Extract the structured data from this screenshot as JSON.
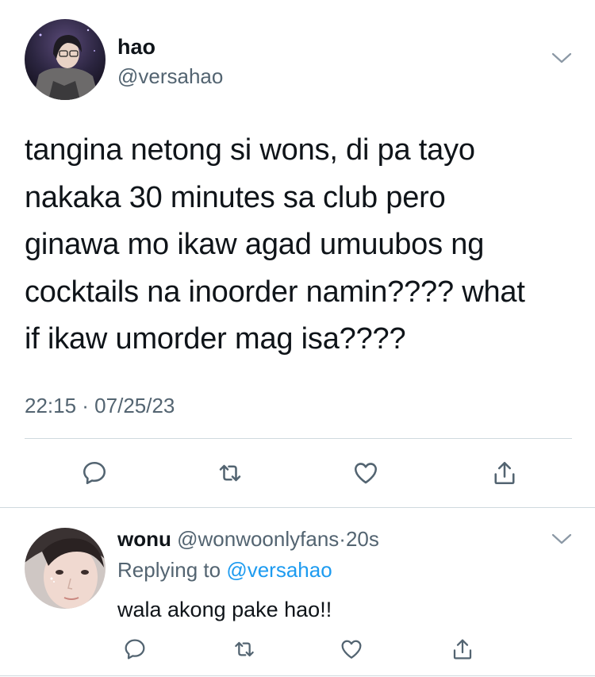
{
  "tweet": {
    "display_name": "hao",
    "handle": "@versahao",
    "text": "tangina netong si wons, di pa tayo\nnakaka 30 minutes sa club pero\nginawa mo ikaw agad umuubos ng\ncocktails na inoorder namin???? what\nif ikaw umorder mag isa????",
    "timestamp": "22:15 · 07/25/23",
    "actions": [
      "reply-icon",
      "retweet-icon",
      "like-icon",
      "share-icon"
    ]
  },
  "reply": {
    "display_name": "wonu",
    "handle": "@wonwoonlyfans",
    "separator": "·",
    "age": "20s",
    "replying_to_label": "Replying to",
    "replying_to_handle": "@versahao",
    "text": "wala akong pake hao!!",
    "actions": [
      "reply-icon",
      "retweet-icon",
      "like-icon",
      "share-icon"
    ]
  },
  "colors": {
    "text": "#0f1419",
    "secondary": "#536471",
    "accent": "#1d9bf0",
    "divider": "#cfd9de"
  }
}
